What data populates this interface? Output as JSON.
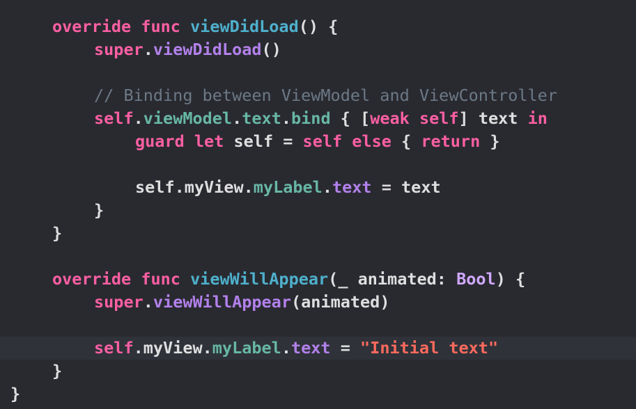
{
  "editor": {
    "lines": [
      {
        "tokens": [
          {
            "text": "override",
            "kind": "kw"
          },
          {
            "text": " ",
            "kind": "plain"
          },
          {
            "text": "func",
            "kind": "kw"
          },
          {
            "text": " ",
            "kind": "plain"
          },
          {
            "text": "viewDidLoad",
            "kind": "fn"
          },
          {
            "text": "() {",
            "kind": "plain"
          }
        ]
      },
      {
        "tokens": [
          {
            "text": "super",
            "kind": "kw"
          },
          {
            "text": ".",
            "kind": "plain"
          },
          {
            "text": "viewDidLoad",
            "kind": "mem"
          },
          {
            "text": "()",
            "kind": "plain"
          }
        ]
      },
      {
        "tokens": []
      },
      {
        "tokens": [
          {
            "text": "// Binding between ViewModel and ViewController",
            "kind": "cmt"
          }
        ]
      },
      {
        "tokens": [
          {
            "text": "self",
            "kind": "kw"
          },
          {
            "text": ".",
            "kind": "plain"
          },
          {
            "text": "viewModel",
            "kind": "prop"
          },
          {
            "text": ".",
            "kind": "plain"
          },
          {
            "text": "text",
            "kind": "prop"
          },
          {
            "text": ".",
            "kind": "plain"
          },
          {
            "text": "bind",
            "kind": "prop"
          },
          {
            "text": " { [",
            "kind": "plain"
          },
          {
            "text": "weak",
            "kind": "kw"
          },
          {
            "text": " ",
            "kind": "plain"
          },
          {
            "text": "self",
            "kind": "kw"
          },
          {
            "text": "] text ",
            "kind": "plain"
          },
          {
            "text": "in",
            "kind": "kw"
          }
        ]
      },
      {
        "tokens": [
          {
            "text": "guard",
            "kind": "kw"
          },
          {
            "text": " ",
            "kind": "plain"
          },
          {
            "text": "let",
            "kind": "kw"
          },
          {
            "text": " self = ",
            "kind": "plain"
          },
          {
            "text": "self",
            "kind": "kw"
          },
          {
            "text": " ",
            "kind": "plain"
          },
          {
            "text": "else",
            "kind": "kw"
          },
          {
            "text": " { ",
            "kind": "plain"
          },
          {
            "text": "return",
            "kind": "kw"
          },
          {
            "text": " }",
            "kind": "plain"
          }
        ]
      },
      {
        "tokens": []
      },
      {
        "tokens": [
          {
            "text": "self.myView.",
            "kind": "plain"
          },
          {
            "text": "myLabel",
            "kind": "prop"
          },
          {
            "text": ".",
            "kind": "plain"
          },
          {
            "text": "text",
            "kind": "mem"
          },
          {
            "text": " = text",
            "kind": "plain"
          }
        ]
      },
      {
        "tokens": [
          {
            "text": "}",
            "kind": "plain"
          }
        ]
      },
      {
        "tokens": [
          {
            "text": "}",
            "kind": "plain"
          }
        ]
      },
      {
        "tokens": []
      },
      {
        "tokens": [
          {
            "text": "override",
            "kind": "kw"
          },
          {
            "text": " ",
            "kind": "plain"
          },
          {
            "text": "func",
            "kind": "kw"
          },
          {
            "text": " ",
            "kind": "plain"
          },
          {
            "text": "viewWillAppear",
            "kind": "fn"
          },
          {
            "text": "(_ animated: ",
            "kind": "plain"
          },
          {
            "text": "Bool",
            "kind": "type"
          },
          {
            "text": ") {",
            "kind": "plain"
          }
        ]
      },
      {
        "tokens": [
          {
            "text": "super",
            "kind": "kw"
          },
          {
            "text": ".",
            "kind": "plain"
          },
          {
            "text": "viewWillAppear",
            "kind": "mem"
          },
          {
            "text": "(animated)",
            "kind": "plain"
          }
        ]
      },
      {
        "tokens": []
      },
      {
        "tokens": [
          {
            "text": "self",
            "kind": "kw"
          },
          {
            "text": ".myView.",
            "kind": "plain"
          },
          {
            "text": "myLabel",
            "kind": "prop"
          },
          {
            "text": ".",
            "kind": "plain"
          },
          {
            "text": "text",
            "kind": "mem"
          },
          {
            "text": " = ",
            "kind": "plain"
          },
          {
            "text": "\"Initial text\"",
            "kind": "str"
          }
        ],
        "current": true
      },
      {
        "tokens": [
          {
            "text": "}",
            "kind": "plain"
          }
        ]
      },
      {
        "tokens": [
          {
            "text": "}",
            "kind": "plain"
          }
        ]
      }
    ]
  },
  "colors": {
    "background": "#292a30",
    "current_line": "#2f3239",
    "keyword": "#fc5fa3",
    "declaration": "#4eb0cc",
    "member": "#b281eb",
    "property": "#67b7a4",
    "type": "#d0a8ff",
    "comment": "#6c7986",
    "string": "#fc6a5d",
    "plain": "#dfdfe0"
  }
}
